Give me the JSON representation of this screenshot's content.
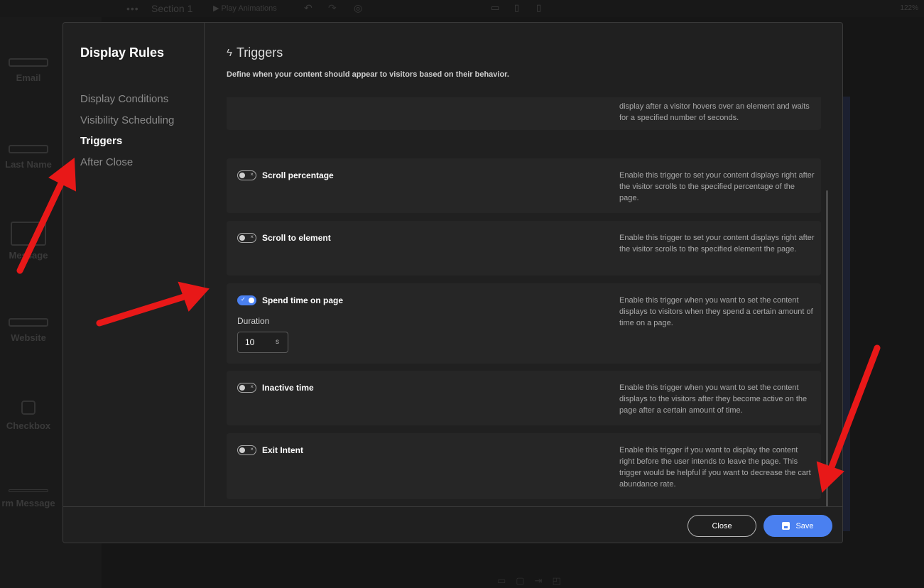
{
  "editor": {
    "section_label": "Section 1",
    "play_label": "Play Animations",
    "zoom": "122%",
    "fields": [
      "Email",
      "Last Name",
      "Message",
      "Website",
      "Checkbox",
      "rm Message"
    ]
  },
  "modal": {
    "title": "Display Rules",
    "nav": [
      {
        "label": "Display Conditions",
        "active": false
      },
      {
        "label": "Visibility Scheduling",
        "active": false
      },
      {
        "label": "Triggers",
        "active": true
      },
      {
        "label": "After Close",
        "active": false
      }
    ],
    "section_title": "Triggers",
    "section_description": "Define when your content should appear to visitors based on their behavior.",
    "partial_card_desc": "display after a visitor hovers over an element and waits for a specified number of seconds.",
    "triggers": [
      {
        "name": "Scroll percentage",
        "enabled": false,
        "description": "Enable this trigger to set your content displays right after the visitor scrolls to the specified percentage of the page."
      },
      {
        "name": "Scroll to element",
        "enabled": false,
        "description": "Enable this trigger to set your content displays right after the visitor scrolls to the specified element the page."
      },
      {
        "name": "Spend time on page",
        "enabled": true,
        "description": "Enable this trigger when you want to set the content displays to visitors when they spend a certain amount of time on a page."
      },
      {
        "name": "Inactive time",
        "enabled": false,
        "description": "Enable this trigger when you want to set the content displays to the visitors after they become active on the page after a certain amount of time."
      },
      {
        "name": "Exit Intent",
        "enabled": false,
        "description": "Enable this trigger if you want to display the content right before the user intends to leave the page. This trigger would be helpful if you want to decrease the cart abundance rate."
      }
    ],
    "duration": {
      "label": "Duration",
      "value": "10",
      "unit": "s"
    },
    "footer": {
      "close_label": "Close",
      "save_label": "Save"
    }
  },
  "colors": {
    "accent": "#4a80f0",
    "annotation_arrow": "#e81818"
  }
}
